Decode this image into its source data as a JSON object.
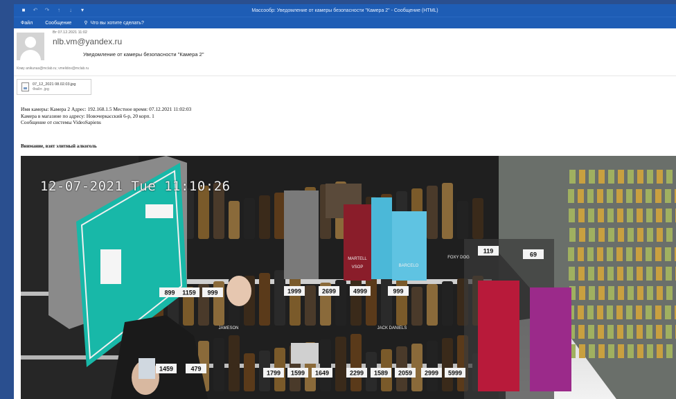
{
  "window": {
    "title": "Массообр: Уведомление от камеры безопасности \"Камера 2\" - Сообщение (HTML)"
  },
  "ribbon": {
    "file": "Файл",
    "message": "Сообщение",
    "tell_me": "Что вы хотите сделать?"
  },
  "email": {
    "sent": "Вт 07.12.2021 11:02",
    "from": "nlb.vm@yandex.ru",
    "subject": "Уведомление от камеры безопасности \"Камера 2\"",
    "to": "Кому   anikunas@mclab.ru; vmelidov@mclab.ru"
  },
  "attachment": {
    "name": "07_12_2021 08.02.03.jpg",
    "type": "Файл .jpg"
  },
  "body": {
    "line1": "Имя камеры: Камера 2 Адрес: 192.168.1.5 Местное время: 07.12.2021 11:02:03",
    "line2": "Камера в магазине по адресу: Новочеркасский 6-р, 20 корп. 1",
    "line3": "Сообщение от системы VideoSapiens",
    "warning": "Внимание, взят элитный алкоголь"
  },
  "camera": {
    "timestamp": "12-07-2021 Tue 11:10:26",
    "prices": [
      "899",
      "1159",
      "999",
      "1999",
      "2699",
      "4999",
      "999",
      "119",
      "69",
      "1459",
      "479",
      "1799",
      "1599",
      "1649",
      "2299",
      "1589",
      "2059",
      "2999",
      "5999"
    ],
    "bottle_labels": [
      "MARTELL",
      "VSOP",
      "BARCELO",
      "FOXY DOG",
      "JAMESON",
      "JACK DANIELS"
    ]
  }
}
